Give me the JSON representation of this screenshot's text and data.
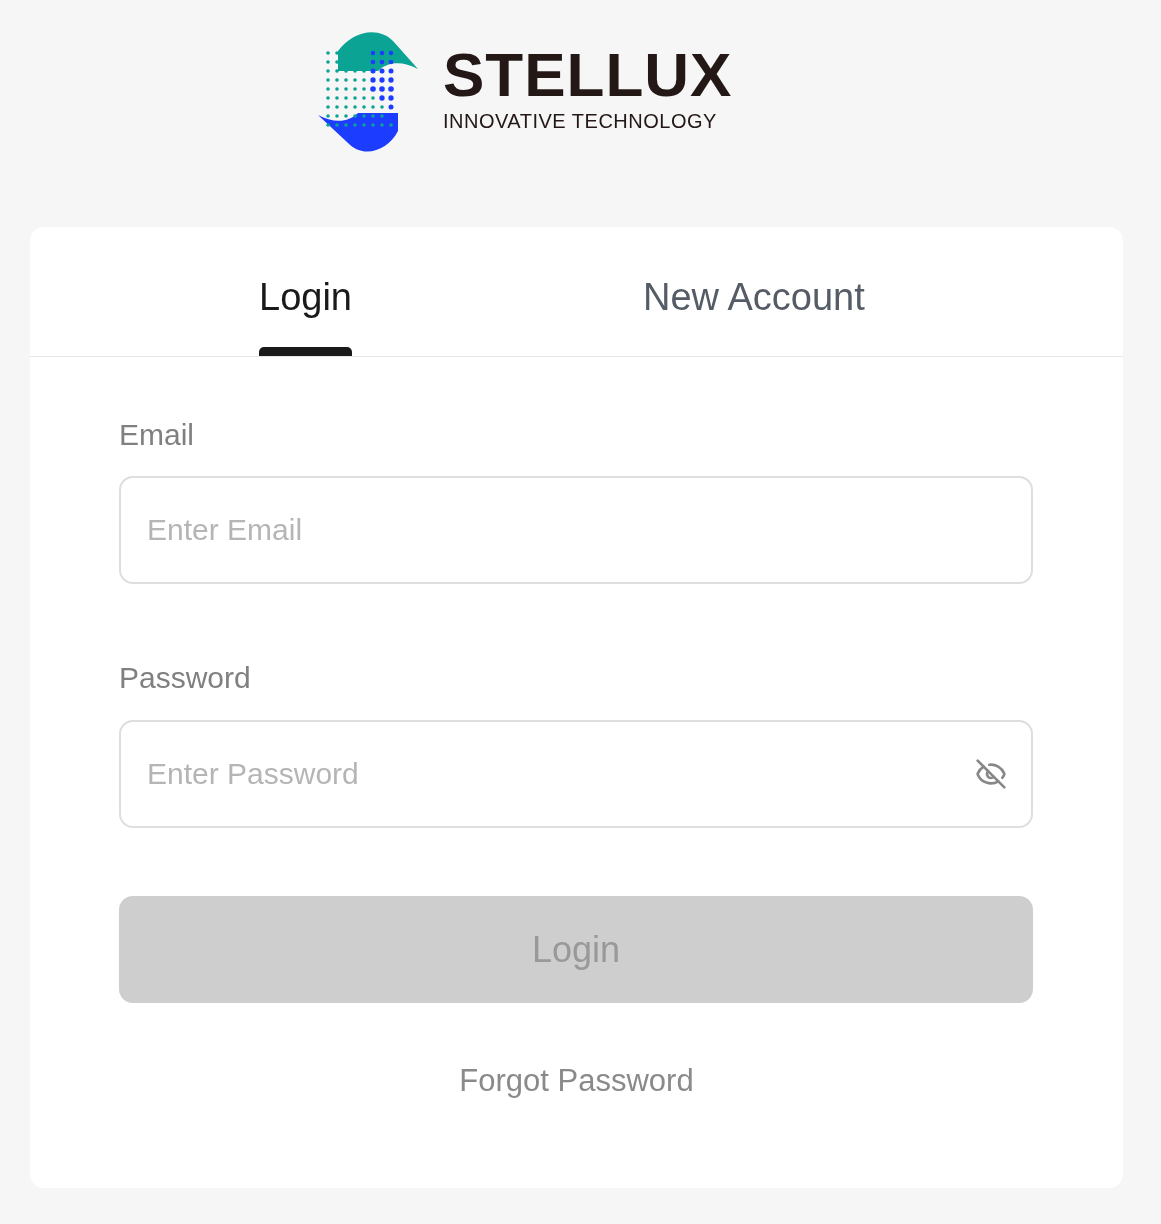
{
  "logo": {
    "name": "STELLUX",
    "tagline": "INNOVATIVE TECHNOLOGY"
  },
  "tabs": [
    {
      "label": "Login",
      "selected": true
    },
    {
      "label": "New Account",
      "selected": false
    }
  ],
  "email": {
    "label": "Email",
    "placeholder": "Enter Email"
  },
  "password": {
    "label": "Password",
    "placeholder": "Enter Password",
    "visible": false
  },
  "login_button": {
    "label": "Login",
    "disabled": true
  },
  "forgot_link": "Forgot Password"
}
